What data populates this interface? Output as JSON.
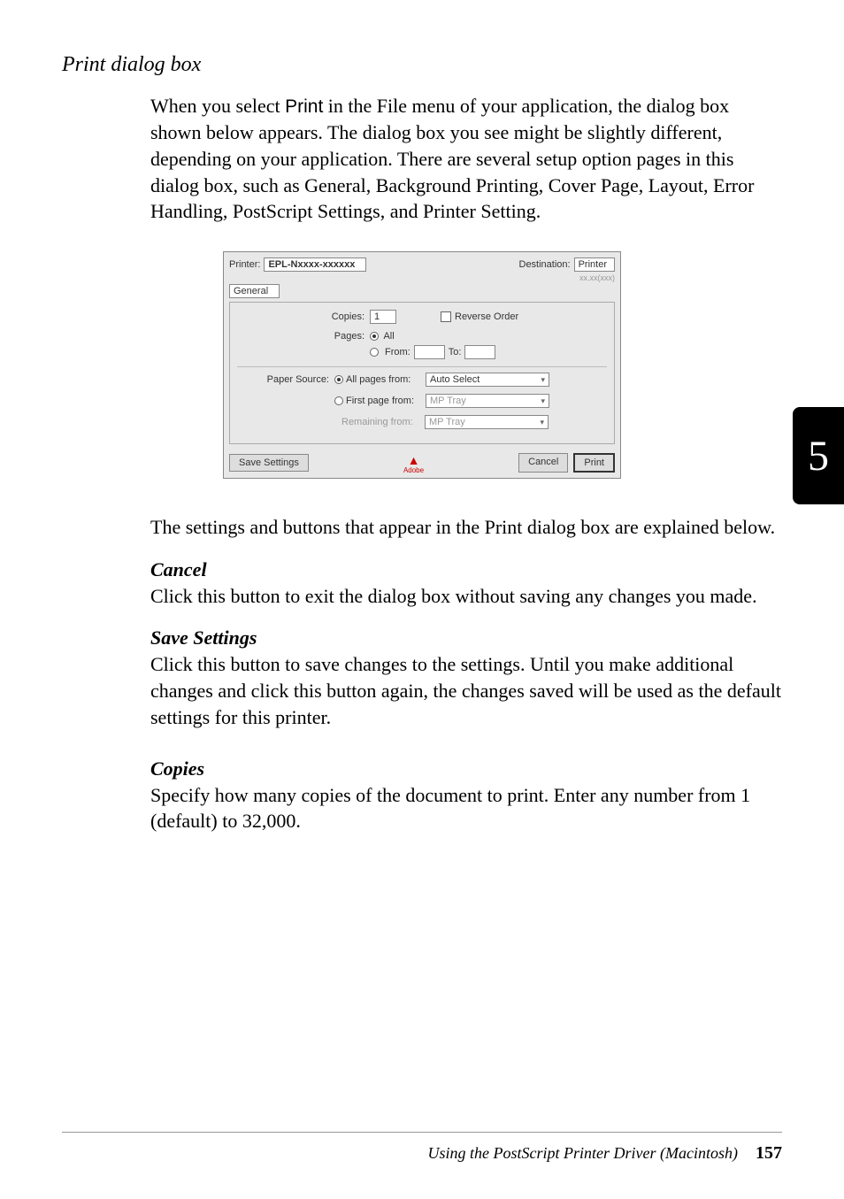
{
  "section": {
    "title": "Print dialog box",
    "intro_pre": "When you select ",
    "intro_print": "Print",
    "intro_post": " in the File menu of your application, the dialog box shown below appears. The dialog box you see might be slightly different, depending on your application. There are several setup option pages in this dialog box, such as General, Background Printing, Cover Page, Layout, Error Handling, PostScript Settings, and Printer Setting.",
    "after_image": "The settings and buttons that appear in the Print dialog box are explained below.",
    "cancel_heading": "Cancel",
    "cancel_text": "Click this button to exit the dialog box without saving any changes you made.",
    "save_heading": "Save Settings",
    "save_text": "Click this button to save changes to the settings. Until you make additional changes and click this button again, the changes saved will be used as the default settings for this printer.",
    "copies_heading": "Copies",
    "copies_text": "Specify how many copies of the document to print. Enter any number from 1 (default) to 32,000."
  },
  "dialog": {
    "printer_label": "Printer:",
    "printer_value": "EPL-Nxxxx-xxxxxx",
    "destination_label": "Destination:",
    "destination_value": "Printer",
    "version": "xx.xx(xxx)",
    "tab": "General",
    "copies_label": "Copies:",
    "copies_value": "1",
    "reverse_order": "Reverse Order",
    "pages_label": "Pages:",
    "pages_all": "All",
    "pages_from": "From:",
    "pages_to": "To:",
    "paper_source_label": "Paper Source:",
    "paper_source_all": "All pages from:",
    "paper_source_value": "Auto Select",
    "first_page_label": "First page from:",
    "first_page_value": "MP Tray",
    "remaining_label": "Remaining from:",
    "remaining_value": "MP Tray",
    "save_settings_btn": "Save Settings",
    "adobe_text": "Adobe",
    "cancel_btn": "Cancel",
    "print_btn": "Print"
  },
  "tab": {
    "number": "5"
  },
  "footer": {
    "title": "Using the PostScript Printer Driver (Macintosh)",
    "page": "157"
  }
}
